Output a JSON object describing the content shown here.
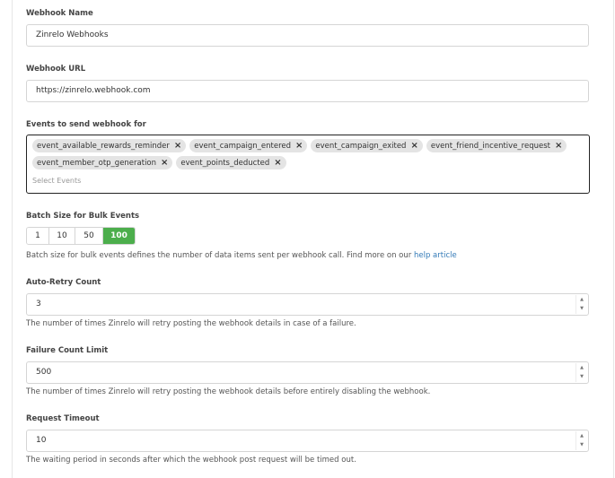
{
  "webhook_name": {
    "label": "Webhook Name",
    "value": "Zinrelo Webhooks"
  },
  "webhook_url": {
    "label": "Webhook URL",
    "value": "https://zinrelo.webhook.com"
  },
  "events": {
    "label": "Events to send webhook for",
    "tags": [
      "event_available_rewards_reminder",
      "event_campaign_entered",
      "event_campaign_exited",
      "event_friend_incentive_request",
      "event_member_otp_generation",
      "event_points_deducted"
    ],
    "remove_icon": "close-icon",
    "placeholder": "Select Events"
  },
  "batch_size": {
    "label": "Batch Size for Bulk Events",
    "options": [
      "1",
      "10",
      "50",
      "100"
    ],
    "selected": "100",
    "help_text": "Batch size for bulk events defines the number of data items sent per webhook call. Find more on our ",
    "help_link": "help article"
  },
  "auto_retry": {
    "label": "Auto-Retry Count",
    "value": "3",
    "help_text": "The number of times Zinrelo will retry posting the webhook details in case of a failure."
  },
  "failure_limit": {
    "label": "Failure Count Limit",
    "value": "500",
    "help_text": "The number of times Zinrelo will retry posting the webhook details before entirely disabling the webhook."
  },
  "request_timeout": {
    "label": "Request Timeout",
    "value": "10",
    "help_text": "The waiting period in seconds after which the webhook post request will be timed out."
  },
  "colors": {
    "active_segment": "#4cae4c",
    "link": "#337ab7",
    "tag_bg": "#e4e4e4"
  }
}
